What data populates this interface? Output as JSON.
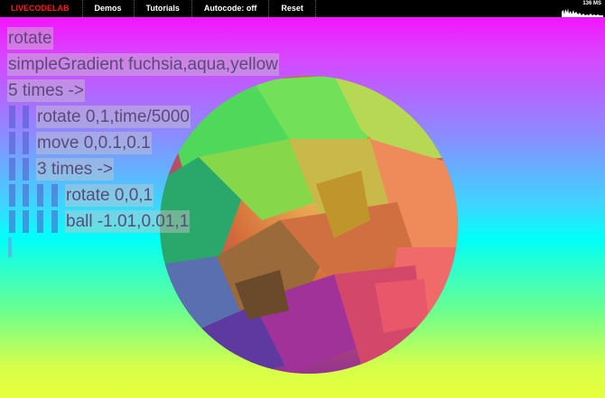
{
  "topbar": {
    "logo": "LIVECODELAB",
    "menu": [
      {
        "id": "demos",
        "label": "Demos"
      },
      {
        "id": "tutorials",
        "label": "Tutorials"
      },
      {
        "id": "autocode",
        "label": "Autocode: off"
      },
      {
        "id": "reset",
        "label": "Reset"
      }
    ],
    "fps_label": "136 MS"
  },
  "editor": {
    "lines": [
      {
        "text": "rotate",
        "indent": 0
      },
      {
        "text": "simpleGradient fuchsia,aqua,yellow",
        "indent": 0
      },
      {
        "text": "5 times ->",
        "indent": 0
      },
      {
        "text": "rotate 0,1,time/5000",
        "indent": 1
      },
      {
        "text": "move 0,0.1,0.1",
        "indent": 1
      },
      {
        "text": "3 times ->",
        "indent": 1
      },
      {
        "text": "rotate 0,0,1",
        "indent": 2
      },
      {
        "text": "ball -1.01,0.01,1",
        "indent": 2
      }
    ]
  },
  "colors": {
    "gradient_top": "#ff00ff",
    "gradient_mid": "#00ffff",
    "gradient_bottom": "#e8ff3a",
    "logo": "#ff1a1a"
  }
}
